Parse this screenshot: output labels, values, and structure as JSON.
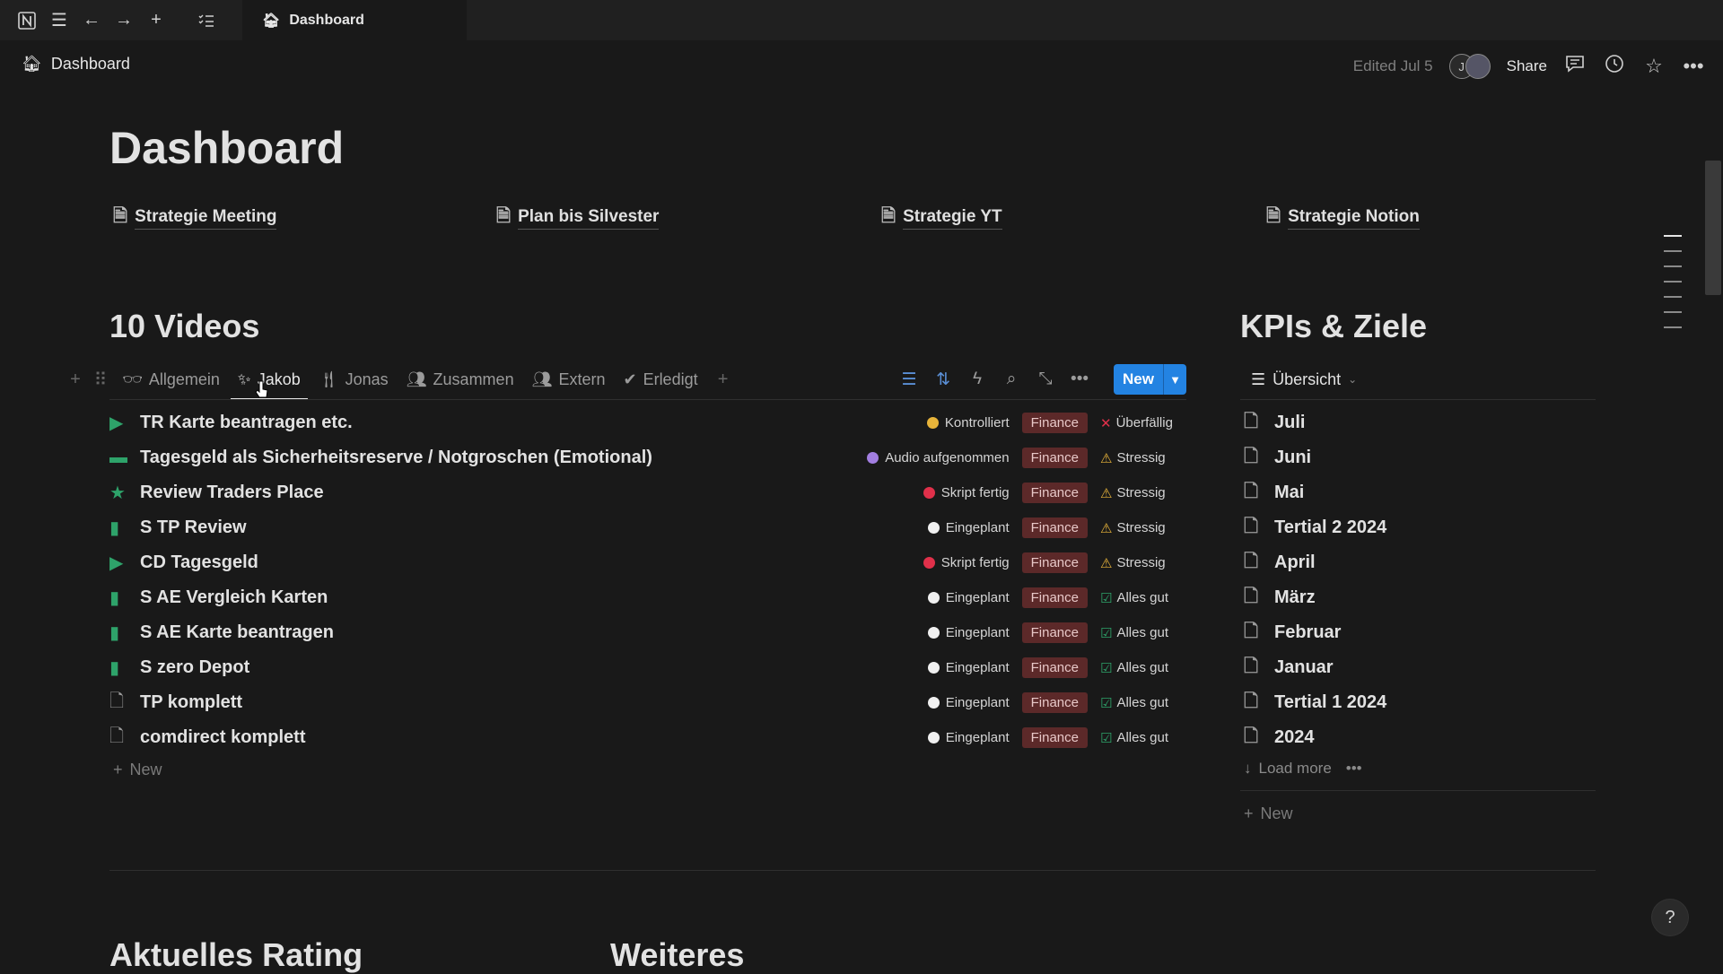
{
  "tab": {
    "title": "Dashboard"
  },
  "breadcrumb": {
    "label": "Dashboard"
  },
  "header": {
    "edited": "Edited Jul 5",
    "avatar_initial": "J",
    "share": "Share"
  },
  "page": {
    "title": "Dashboard"
  },
  "links": [
    "Strategie Meeting",
    "Plan bis Silvester",
    "Strategie YT",
    "Strategie Notion"
  ],
  "videos": {
    "heading": "10 Videos",
    "views": [
      "Allgemein",
      "Jakob",
      "Jonas",
      "Zusammen",
      "Extern",
      "Erledigt"
    ],
    "new_button": "New",
    "rows": [
      {
        "icon": "video-icon",
        "title": "TR Karte beantragen etc.",
        "status": "Kontrolliert",
        "status_color": "#e8b43a",
        "category": "Finance",
        "mood": "Überfällig",
        "mood_icon": "x-icon"
      },
      {
        "icon": "monitor-icon",
        "title": "Tagesgeld als Sicherheitsreserve / Notgroschen (Emotional)",
        "status": "Audio aufgenommen",
        "status_color": "#a27ee0",
        "category": "Finance",
        "mood": "Stressig",
        "mood_icon": "warning-icon"
      },
      {
        "icon": "star-icon",
        "title": "Review Traders Place",
        "status": "Skript fertig",
        "status_color": "#e0304a",
        "category": "Finance",
        "mood": "Stressig",
        "mood_icon": "warning-icon"
      },
      {
        "icon": "phone-icon",
        "title": "S TP Review",
        "status": "Eingeplant",
        "status_color": "#f0f0f0",
        "category": "Finance",
        "mood": "Stressig",
        "mood_icon": "warning-icon"
      },
      {
        "icon": "video-icon",
        "title": "CD Tagesgeld",
        "status": "Skript fertig",
        "status_color": "#e0304a",
        "category": "Finance",
        "mood": "Stressig",
        "mood_icon": "warning-icon"
      },
      {
        "icon": "phone-icon",
        "title": "S AE Vergleich Karten",
        "status": "Eingeplant",
        "status_color": "#f0f0f0",
        "category": "Finance",
        "mood": "Alles gut",
        "mood_icon": "check-icon"
      },
      {
        "icon": "phone-icon",
        "title": "S AE Karte beantragen",
        "status": "Eingeplant",
        "status_color": "#f0f0f0",
        "category": "Finance",
        "mood": "Alles gut",
        "mood_icon": "check-icon"
      },
      {
        "icon": "phone-icon",
        "title": "S zero Depot",
        "status": "Eingeplant",
        "status_color": "#f0f0f0",
        "category": "Finance",
        "mood": "Alles gut",
        "mood_icon": "check-icon"
      },
      {
        "icon": "document-icon",
        "title": "TP komplett",
        "status": "Eingeplant",
        "status_color": "#f0f0f0",
        "category": "Finance",
        "mood": "Alles gut",
        "mood_icon": "check-icon"
      },
      {
        "icon": "document-icon",
        "title": "comdirect komplett",
        "status": "Eingeplant",
        "status_color": "#f0f0f0",
        "category": "Finance",
        "mood": "Alles gut",
        "mood_icon": "check-icon"
      }
    ],
    "add_new": "New"
  },
  "kpis": {
    "heading": "KPIs & Ziele",
    "view": "Übersicht",
    "items": [
      "Juli",
      "Juni",
      "Mai",
      "Tertial 2 2024",
      "April",
      "März",
      "Februar",
      "Januar",
      "Tertial 1 2024",
      "2024"
    ],
    "load_more": "Load more",
    "add_new": "New"
  },
  "bottom": {
    "rating_heading": "Aktuelles Rating",
    "weiteres_heading": "Weiteres"
  },
  "help": "?",
  "colors": {
    "accent": "#2383e2",
    "tag_bg": "#5c2929",
    "background": "#191919"
  }
}
